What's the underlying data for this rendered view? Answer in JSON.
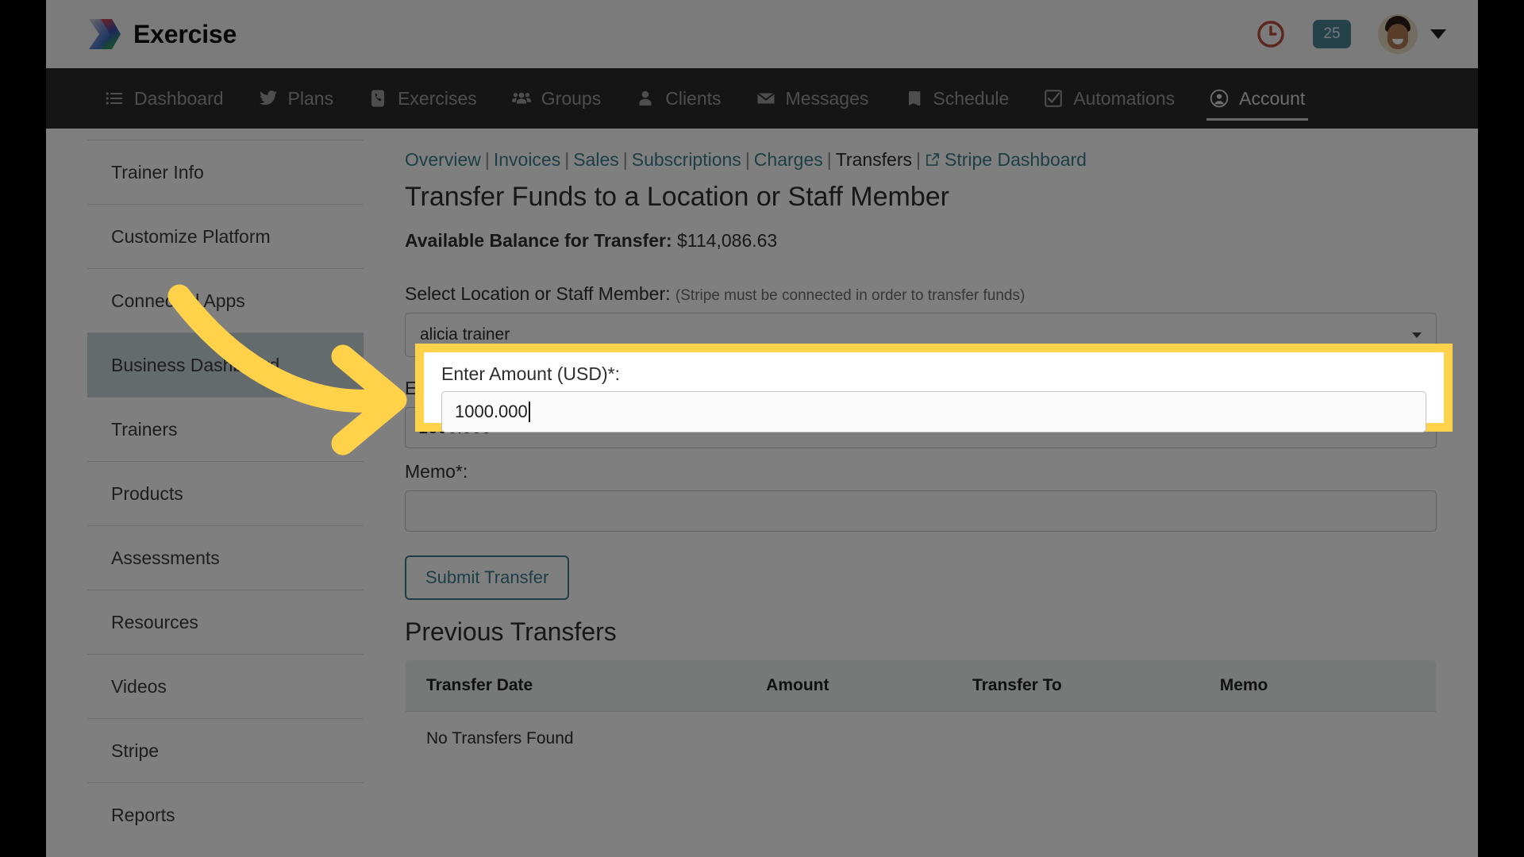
{
  "app": {
    "name": "Exercise",
    "logo_icon": "chevron-stack-logo"
  },
  "header": {
    "clock_icon": "clock-icon",
    "clock_color": "#b94f3e",
    "badge_count": "25",
    "badge_color": "#4a8295",
    "avatar_icon": "user-avatar",
    "dropdown_icon": "chevron-down-icon"
  },
  "nav": {
    "items": [
      {
        "label": "Dashboard",
        "icon": "list-icon",
        "active": false
      },
      {
        "label": "Plans",
        "icon": "bird-icon",
        "active": false
      },
      {
        "label": "Exercises",
        "icon": "phone-icon",
        "active": false
      },
      {
        "label": "Groups",
        "icon": "people-icon",
        "active": false
      },
      {
        "label": "Clients",
        "icon": "person-icon",
        "active": false
      },
      {
        "label": "Messages",
        "icon": "envelope-icon",
        "active": false
      },
      {
        "label": "Schedule",
        "icon": "book-icon",
        "active": false
      },
      {
        "label": "Automations",
        "icon": "check-box-icon",
        "active": false
      },
      {
        "label": "Account",
        "icon": "user-circle-icon",
        "active": true
      }
    ]
  },
  "sidebar": {
    "items": [
      {
        "label": "Trainer Info",
        "active": false
      },
      {
        "label": "Customize Platform",
        "active": false
      },
      {
        "label": "Connected Apps",
        "active": false
      },
      {
        "label": "Business Dashboard",
        "active": true
      },
      {
        "label": "Trainers",
        "active": false
      },
      {
        "label": "Products",
        "active": false
      },
      {
        "label": "Assessments",
        "active": false
      },
      {
        "label": "Resources",
        "active": false
      },
      {
        "label": "Videos",
        "active": false
      },
      {
        "label": "Stripe",
        "active": false
      },
      {
        "label": "Reports",
        "active": false
      }
    ]
  },
  "breadcrumb": {
    "links": [
      {
        "label": "Overview",
        "active": false
      },
      {
        "label": "Invoices",
        "active": false
      },
      {
        "label": "Sales",
        "active": false
      },
      {
        "label": "Subscriptions",
        "active": false
      },
      {
        "label": "Charges",
        "active": false
      },
      {
        "label": "Transfers",
        "active": true
      },
      {
        "label": "Stripe Dashboard",
        "active": false,
        "icon": "external-link-icon"
      }
    ],
    "separator": "|"
  },
  "main": {
    "page_title": "Transfer Funds to a Location or Staff Member",
    "balance_label": "Available Balance for Transfer:",
    "balance_value": "$114,086.63",
    "select_label": "Select Location or Staff Member:",
    "select_hint": "(Stripe must be connected in order to transfer funds)",
    "select_value": "alicia trainer",
    "select_caret_icon": "caret-down-icon",
    "amount_label": "Enter Amount (USD)*:",
    "amount_value": "1000.000",
    "memo_label": "Memo*:",
    "memo_value": "",
    "submit_label": "Submit Transfer",
    "previous_title": "Previous Transfers",
    "table": {
      "columns": [
        "Transfer Date",
        "Amount",
        "Transfer To",
        "Memo"
      ],
      "empty_message": "No Transfers Found",
      "rows": []
    }
  },
  "annotation": {
    "highlight_color": "#FFD24A",
    "arrow_icon": "curved-arrow-right",
    "arrow_color": "#FFD24A"
  }
}
